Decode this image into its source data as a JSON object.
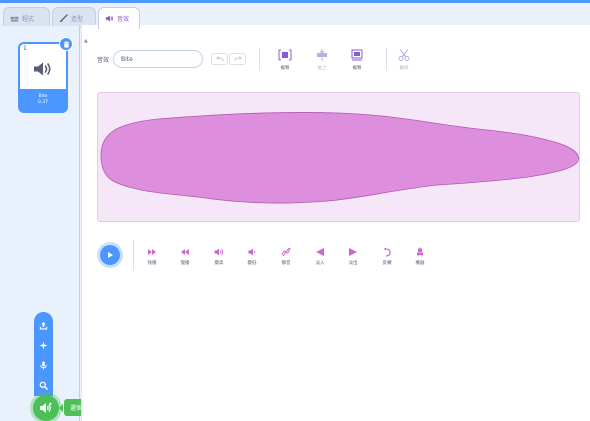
{
  "tabs": {
    "code": "程式",
    "costume": "造型",
    "sound": "音效"
  },
  "sound_list": {
    "number": "1",
    "name": "Bite",
    "duration": "0.37"
  },
  "add_menu": {
    "tooltip": "選個音效",
    "items": [
      "upload-icon",
      "surprise-icon",
      "record-icon",
      "search-icon"
    ]
  },
  "editor": {
    "name_label": "音效",
    "name_value": "Bite",
    "tools": [
      {
        "label": "複製",
        "icon": "copy-icon",
        "disabled": false
      },
      {
        "label": "貼上",
        "icon": "paste-icon",
        "disabled": true
      },
      {
        "label": "複製",
        "icon": "copy-new-icon",
        "disabled": false
      },
      {
        "label": "刪除",
        "icon": "delete-icon",
        "disabled": true
      }
    ],
    "effects": [
      {
        "label": "快播",
        "icon": "faster-icon"
      },
      {
        "label": "慢播",
        "icon": "slower-icon"
      },
      {
        "label": "變高",
        "icon": "louder-icon"
      },
      {
        "label": "變低",
        "icon": "softer-icon"
      },
      {
        "label": "靜音",
        "icon": "mute-icon"
      },
      {
        "label": "淡入",
        "icon": "fade-in-icon"
      },
      {
        "label": "淡出",
        "icon": "fade-out-icon"
      },
      {
        "label": "反轉",
        "icon": "reverse-icon"
      },
      {
        "label": "機器",
        "icon": "robot-icon"
      }
    ]
  },
  "colors": {
    "accent": "#4c97ff",
    "sound_purple": "#cf63cf",
    "wave_fill": "#dd8fdd",
    "wave_bg": "#f5e6f8",
    "add_green": "#4cbf56"
  }
}
